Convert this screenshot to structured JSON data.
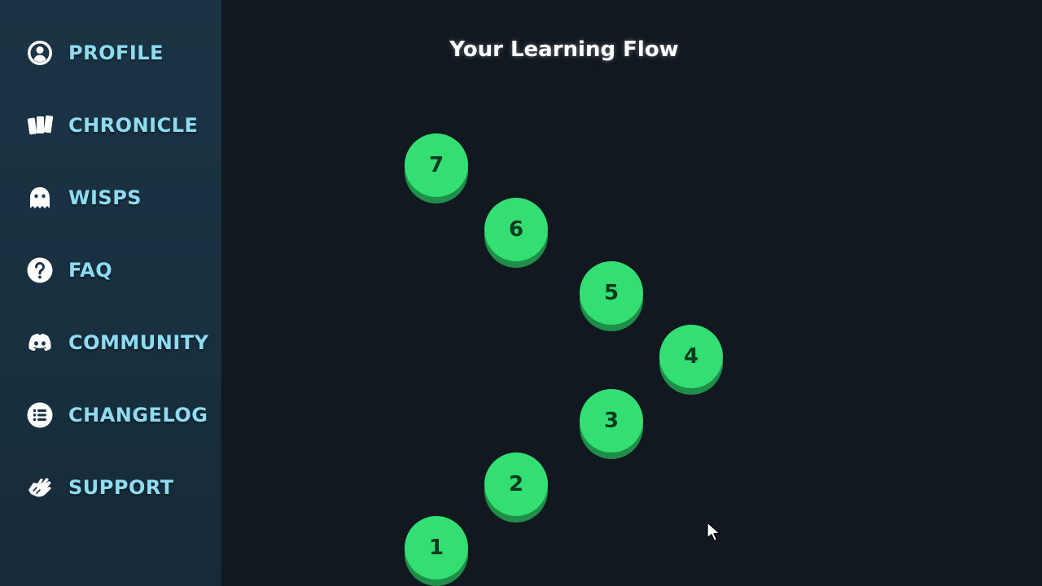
{
  "sidebar": {
    "items": [
      {
        "label": "PROFILE",
        "icon": "profile-icon"
      },
      {
        "label": "CHRONICLE",
        "icon": "cards-icon"
      },
      {
        "label": "WISPS",
        "icon": "ghost-icon"
      },
      {
        "label": "FAQ",
        "icon": "question-icon"
      },
      {
        "label": "COMMUNITY",
        "icon": "discord-icon"
      },
      {
        "label": "CHANGELOG",
        "icon": "list-icon"
      },
      {
        "label": "SUPPORT",
        "icon": "handshake-icon"
      }
    ]
  },
  "main": {
    "title": "Your Learning Flow",
    "nodes": [
      {
        "label": "7"
      },
      {
        "label": "6"
      },
      {
        "label": "5"
      },
      {
        "label": "4"
      },
      {
        "label": "3"
      },
      {
        "label": "2"
      },
      {
        "label": "1"
      }
    ]
  },
  "colors": {
    "sidebar_bg": "#1b3445",
    "main_bg": "#121820",
    "nav_text": "#8fdcf2",
    "node_face": "#33df72",
    "node_shadow": "#1f8e49",
    "node_text": "#0f3a21"
  }
}
